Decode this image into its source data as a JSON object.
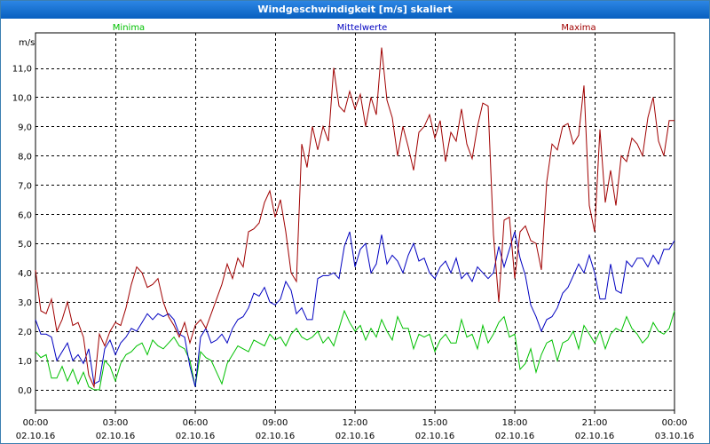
{
  "window": {
    "title": "Windgeschwindigkeit [m/s] skaliert"
  },
  "chart_data": {
    "type": "line",
    "title": "Windgeschwindigkeit [m/s] skaliert",
    "ylabel": "m/s",
    "ylim": [
      -0.7,
      12.2
    ],
    "xlim": [
      0,
      24
    ],
    "yticks": [
      "0,0",
      "1,0",
      "2,0",
      "3,0",
      "4,0",
      "5,0",
      "6,0",
      "7,0",
      "8,0",
      "9,0",
      "10,0",
      "11,0"
    ],
    "yticks_values": [
      0,
      1,
      2,
      3,
      4,
      5,
      6,
      7,
      8,
      9,
      10,
      11
    ],
    "xticks": [
      {
        "time": "00:00",
        "date": "02.10.16"
      },
      {
        "time": "03:00",
        "date": "02.10.16"
      },
      {
        "time": "06:00",
        "date": "02.10.16"
      },
      {
        "time": "09:00",
        "date": "02.10.16"
      },
      {
        "time": "12:00",
        "date": "02.10.16"
      },
      {
        "time": "15:00",
        "date": "02.10.16"
      },
      {
        "time": "18:00",
        "date": "02.10.16"
      },
      {
        "time": "21:00",
        "date": "02.10.16"
      },
      {
        "time": "00:00",
        "date": "03.10.16"
      }
    ],
    "grid": true,
    "legend_position": "top",
    "series": [
      {
        "name": "Minima",
        "color": "#00c000",
        "x": [
          0.0,
          0.2,
          0.4,
          0.6,
          0.8,
          1.0,
          1.2,
          1.4,
          1.6,
          1.8,
          2.0,
          2.2,
          2.4,
          2.6,
          2.8,
          3.0,
          3.2,
          3.4,
          3.6,
          3.8,
          4.0,
          4.2,
          4.4,
          4.6,
          4.8,
          5.0,
          5.2,
          5.4,
          5.6,
          5.8,
          6.0,
          6.2,
          6.4,
          6.6,
          6.8,
          7.0,
          7.2,
          7.4,
          7.6,
          7.8,
          8.0,
          8.2,
          8.4,
          8.6,
          8.8,
          9.0,
          9.2,
          9.4,
          9.6,
          9.8,
          10.0,
          10.2,
          10.4,
          10.6,
          10.8,
          11.0,
          11.2,
          11.4,
          11.6,
          11.8,
          12.0,
          12.2,
          12.4,
          12.6,
          12.8,
          13.0,
          13.2,
          13.4,
          13.6,
          13.8,
          14.0,
          14.2,
          14.4,
          14.6,
          14.8,
          15.0,
          15.2,
          15.4,
          15.6,
          15.8,
          16.0,
          16.2,
          16.4,
          16.6,
          16.8,
          17.0,
          17.2,
          17.4,
          17.6,
          17.8,
          18.0,
          18.2,
          18.4,
          18.6,
          18.8,
          19.0,
          19.2,
          19.4,
          19.6,
          19.8,
          20.0,
          20.2,
          20.4,
          20.6,
          20.8,
          21.0,
          21.2,
          21.4,
          21.6,
          21.8,
          22.0,
          22.2,
          22.4,
          22.6,
          22.8,
          23.0,
          23.2,
          23.4,
          23.6,
          23.8,
          24.0
        ],
        "y": [
          1.3,
          1.1,
          1.2,
          0.4,
          0.4,
          0.8,
          0.3,
          0.7,
          0.2,
          0.6,
          0.1,
          0.0,
          0.0,
          1.0,
          0.8,
          0.3,
          0.9,
          1.2,
          1.3,
          1.5,
          1.6,
          1.2,
          1.7,
          1.5,
          1.4,
          1.6,
          1.8,
          1.5,
          1.4,
          1.0,
          0.1,
          1.3,
          1.1,
          1.0,
          0.6,
          0.2,
          0.9,
          1.2,
          1.5,
          1.4,
          1.3,
          1.7,
          1.6,
          1.5,
          1.9,
          1.7,
          1.8,
          1.5,
          1.9,
          2.1,
          1.8,
          1.7,
          1.8,
          2.0,
          1.6,
          1.8,
          1.5,
          2.1,
          2.7,
          2.3,
          2.0,
          2.2,
          1.7,
          2.1,
          1.8,
          2.4,
          2.0,
          1.7,
          2.5,
          2.1,
          2.1,
          1.4,
          1.9,
          1.8,
          1.9,
          1.3,
          1.7,
          1.9,
          1.6,
          1.6,
          2.4,
          1.8,
          1.9,
          1.4,
          2.2,
          1.6,
          1.9,
          2.3,
          2.5,
          1.8,
          1.9,
          0.7,
          0.9,
          1.4,
          0.6,
          1.2,
          1.6,
          1.7,
          1.0,
          1.6,
          1.7,
          2.0,
          1.4,
          2.2,
          1.9,
          1.6,
          2.0,
          1.4,
          1.9,
          2.1,
          2.0,
          2.5,
          2.1,
          1.9,
          1.6,
          1.8,
          2.3,
          2.0,
          1.9,
          2.1,
          2.7
        ],
        "legend_x": 145
      },
      {
        "name": "Mittelwerte",
        "color": "#0000c0",
        "x": [
          0.0,
          0.2,
          0.4,
          0.6,
          0.8,
          1.0,
          1.2,
          1.4,
          1.6,
          1.8,
          2.0,
          2.2,
          2.4,
          2.6,
          2.8,
          3.0,
          3.2,
          3.4,
          3.6,
          3.8,
          4.0,
          4.2,
          4.4,
          4.6,
          4.8,
          5.0,
          5.2,
          5.4,
          5.6,
          5.8,
          6.0,
          6.2,
          6.4,
          6.6,
          6.8,
          7.0,
          7.2,
          7.4,
          7.6,
          7.8,
          8.0,
          8.2,
          8.4,
          8.6,
          8.8,
          9.0,
          9.2,
          9.4,
          9.6,
          9.8,
          10.0,
          10.2,
          10.4,
          10.6,
          10.8,
          11.0,
          11.2,
          11.4,
          11.6,
          11.8,
          12.0,
          12.2,
          12.4,
          12.6,
          12.8,
          13.0,
          13.2,
          13.4,
          13.6,
          13.8,
          14.0,
          14.2,
          14.4,
          14.6,
          14.8,
          15.0,
          15.2,
          15.4,
          15.6,
          15.8,
          16.0,
          16.2,
          16.4,
          16.6,
          16.8,
          17.0,
          17.2,
          17.4,
          17.6,
          17.8,
          18.0,
          18.2,
          18.4,
          18.6,
          18.8,
          19.0,
          19.2,
          19.4,
          19.6,
          19.8,
          20.0,
          20.2,
          20.4,
          20.6,
          20.8,
          21.0,
          21.2,
          21.4,
          21.6,
          21.8,
          22.0,
          22.2,
          22.4,
          22.6,
          22.8,
          23.0,
          23.2,
          23.4,
          23.6,
          23.8,
          24.0
        ],
        "y": [
          2.4,
          1.9,
          1.9,
          1.8,
          1.0,
          1.3,
          1.6,
          1.0,
          1.2,
          0.9,
          1.4,
          0.2,
          0.3,
          1.4,
          1.7,
          1.2,
          1.6,
          1.8,
          2.1,
          2.0,
          2.3,
          2.6,
          2.4,
          2.6,
          2.5,
          2.6,
          2.4,
          1.9,
          1.8,
          0.8,
          0.1,
          1.8,
          2.1,
          1.6,
          1.7,
          1.9,
          1.6,
          2.1,
          2.4,
          2.5,
          2.8,
          3.3,
          3.2,
          3.5,
          3.0,
          2.9,
          3.1,
          3.7,
          3.4,
          2.6,
          2.8,
          2.4,
          2.4,
          3.8,
          3.9,
          3.9,
          4.0,
          3.8,
          4.9,
          5.4,
          4.2,
          4.8,
          5.0,
          4.0,
          4.3,
          5.3,
          4.3,
          4.6,
          4.4,
          4.0,
          4.6,
          5.0,
          4.4,
          4.5,
          4.0,
          3.8,
          4.2,
          4.4,
          4.0,
          4.5,
          3.8,
          4.0,
          3.7,
          4.2,
          4.0,
          3.8,
          4.0,
          4.9,
          4.2,
          4.8,
          5.4,
          4.5,
          3.9,
          2.9,
          2.5,
          2.0,
          2.4,
          2.5,
          2.8,
          3.3,
          3.5,
          3.9,
          4.3,
          4.0,
          4.6,
          4.0,
          3.1,
          3.1,
          4.3,
          3.4,
          3.3,
          4.4,
          4.2,
          4.5,
          4.5,
          4.2,
          4.6,
          4.3,
          4.8,
          4.8,
          5.1
        ],
        "legend_x": 408
      },
      {
        "name": "Maxima",
        "color": "#a00000",
        "x": [
          0.0,
          0.2,
          0.4,
          0.6,
          0.8,
          1.0,
          1.2,
          1.4,
          1.6,
          1.8,
          2.0,
          2.2,
          2.4,
          2.6,
          2.8,
          3.0,
          3.2,
          3.4,
          3.6,
          3.8,
          4.0,
          4.2,
          4.4,
          4.6,
          4.8,
          5.0,
          5.2,
          5.4,
          5.6,
          5.8,
          6.0,
          6.2,
          6.4,
          6.6,
          6.8,
          7.0,
          7.2,
          7.4,
          7.6,
          7.8,
          8.0,
          8.2,
          8.4,
          8.6,
          8.8,
          9.0,
          9.2,
          9.4,
          9.6,
          9.8,
          10.0,
          10.2,
          10.4,
          10.6,
          10.8,
          11.0,
          11.2,
          11.4,
          11.6,
          11.8,
          12.0,
          12.2,
          12.4,
          12.6,
          12.8,
          13.0,
          13.2,
          13.4,
          13.6,
          13.8,
          14.0,
          14.2,
          14.4,
          14.6,
          14.8,
          15.0,
          15.2,
          15.4,
          15.6,
          15.8,
          16.0,
          16.2,
          16.4,
          16.6,
          16.8,
          17.0,
          17.2,
          17.4,
          17.6,
          17.8,
          18.0,
          18.2,
          18.4,
          18.6,
          18.8,
          19.0,
          19.2,
          19.4,
          19.6,
          19.8,
          20.0,
          20.2,
          20.4,
          20.6,
          20.8,
          21.0,
          21.2,
          21.4,
          21.6,
          21.8,
          22.0,
          22.2,
          22.4,
          22.6,
          22.8,
          23.0,
          23.2,
          23.4,
          23.6,
          23.8,
          24.0
        ],
        "y": [
          4.1,
          2.7,
          2.6,
          3.1,
          2.0,
          2.4,
          3.0,
          2.2,
          2.3,
          1.8,
          0.5,
          0.1,
          1.9,
          1.5,
          2.0,
          2.3,
          2.2,
          2.8,
          3.6,
          4.2,
          4.0,
          3.5,
          3.6,
          3.8,
          3.0,
          2.5,
          2.2,
          1.8,
          2.3,
          1.6,
          2.2,
          2.4,
          2.1,
          2.6,
          3.1,
          3.6,
          4.3,
          3.8,
          4.5,
          4.2,
          5.4,
          5.5,
          5.7,
          6.4,
          6.8,
          5.9,
          6.5,
          5.4,
          4.0,
          3.7,
          8.4,
          7.6,
          9.0,
          8.2,
          9.0,
          8.5,
          11.0,
          9.7,
          9.5,
          10.2,
          9.6,
          10.1,
          9.0,
          10.0,
          9.4,
          11.7,
          9.9,
          9.3,
          8.0,
          9.0,
          8.3,
          7.5,
          8.8,
          9.0,
          9.4,
          8.6,
          9.2,
          7.8,
          8.8,
          8.5,
          9.6,
          8.4,
          7.9,
          9.0,
          9.8,
          9.7,
          5.3,
          3.0,
          5.8,
          5.9,
          3.8,
          5.4,
          5.6,
          5.1,
          5.0,
          4.1,
          7.1,
          8.4,
          8.2,
          9.0,
          9.1,
          8.4,
          8.7,
          10.4,
          6.3,
          5.4,
          8.9,
          6.4,
          7.5,
          6.3,
          8.0,
          7.8,
          8.6,
          8.4,
          8.0,
          9.3,
          10.0,
          8.5,
          8.0,
          9.2,
          9.2
        ],
        "legend_x": 652
      }
    ]
  }
}
